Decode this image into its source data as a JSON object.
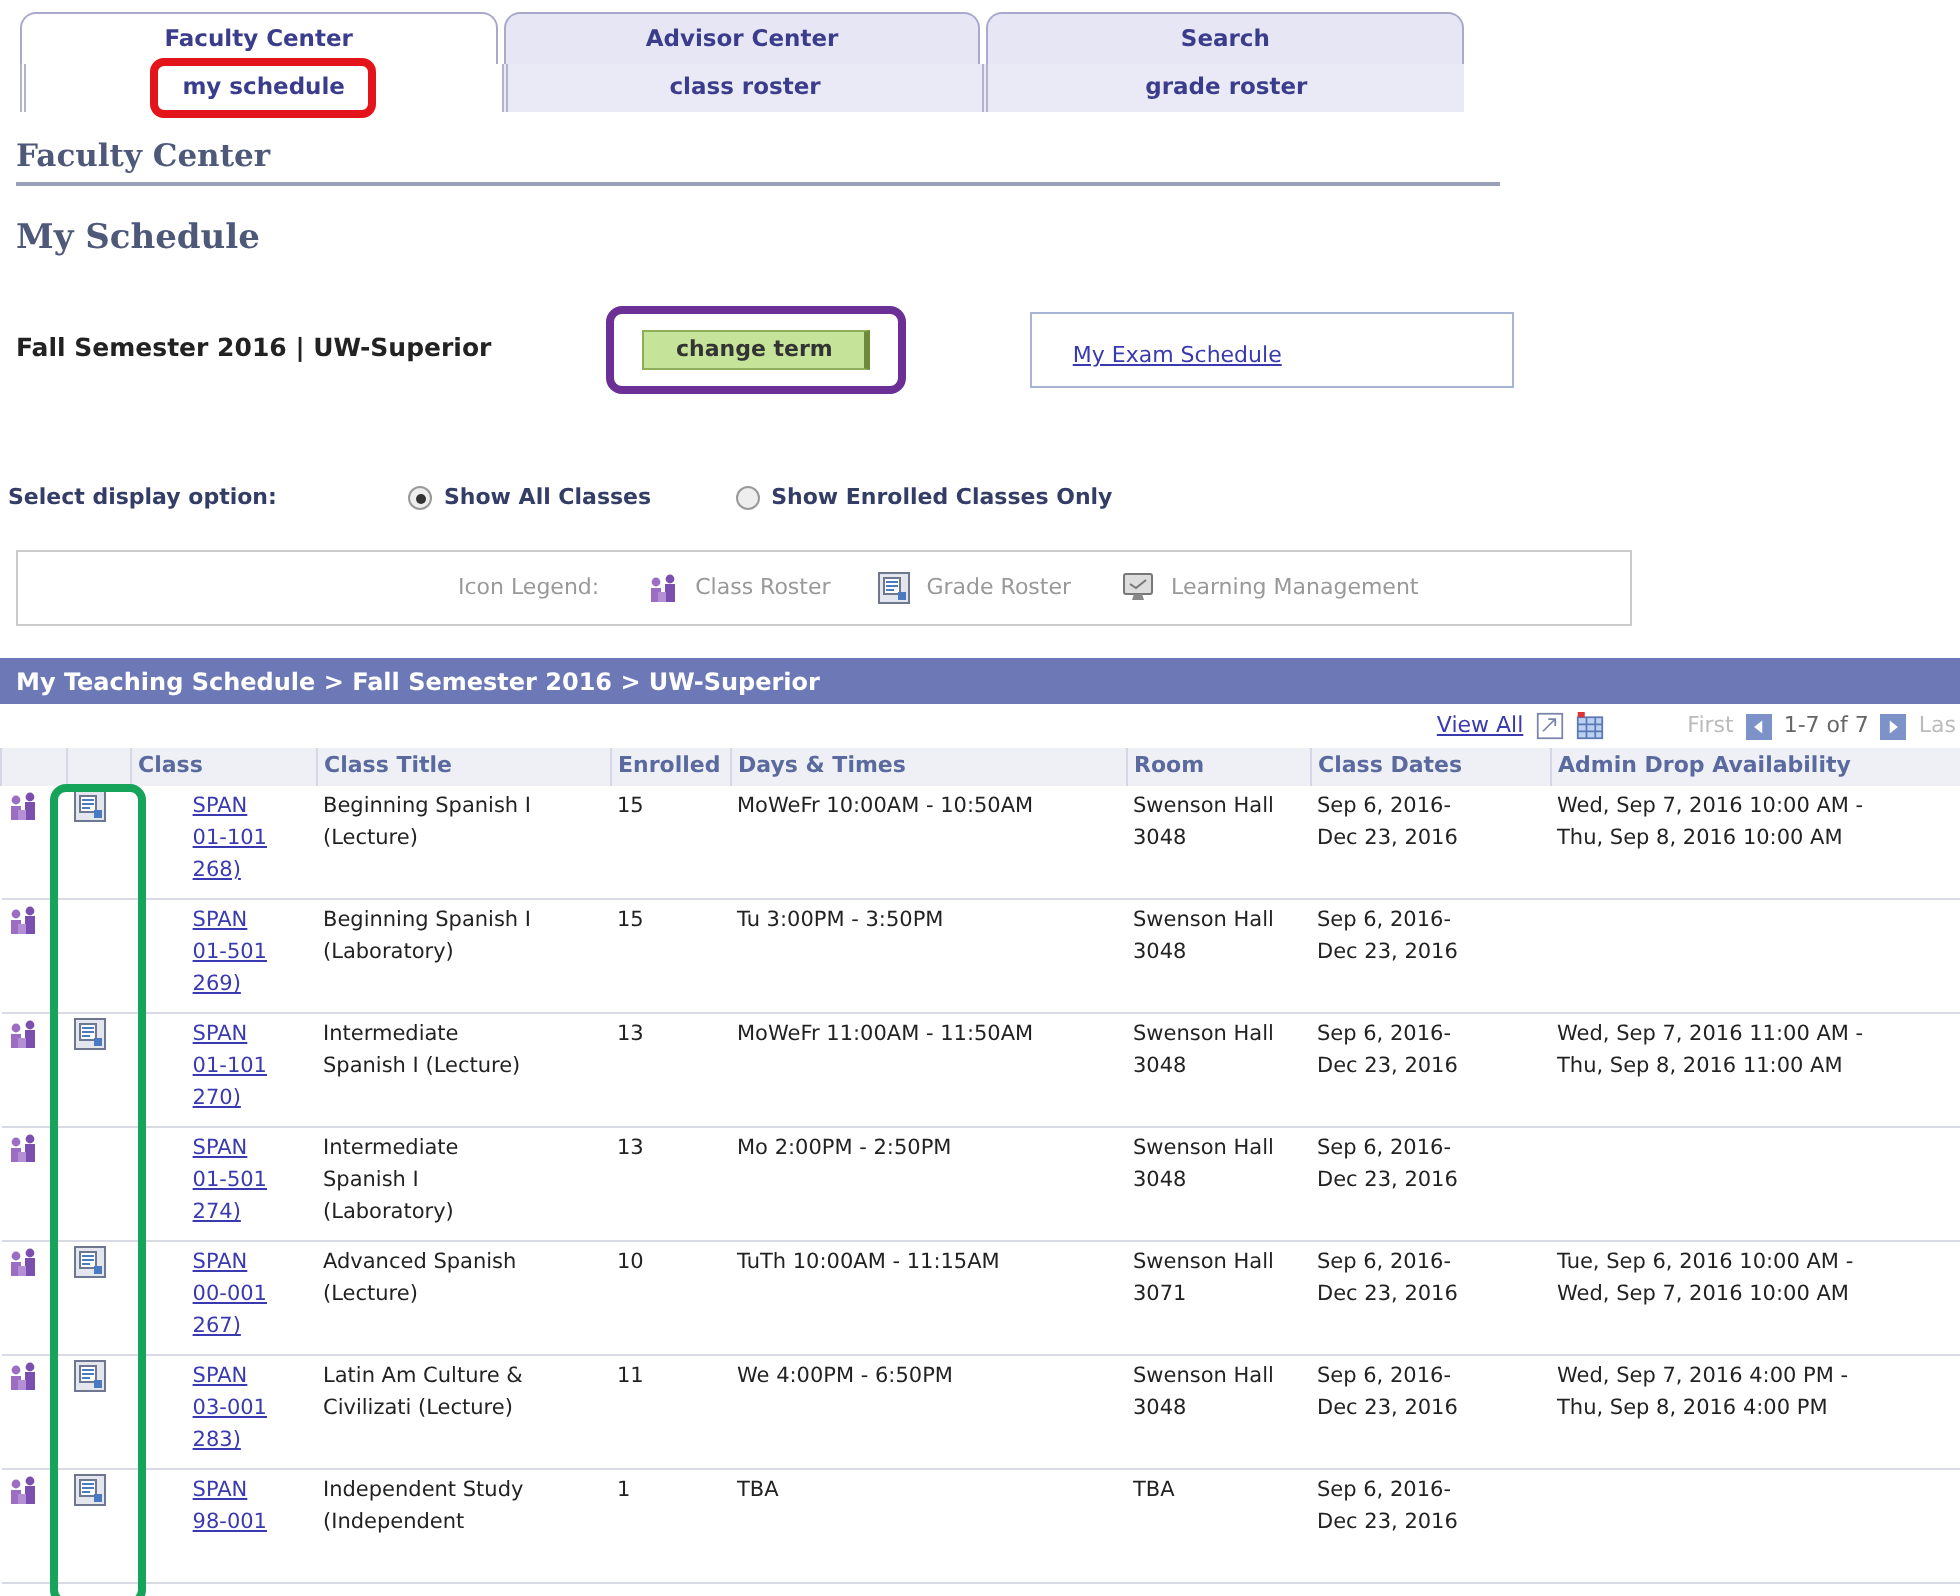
{
  "tabs": [
    {
      "label": "Faculty Center",
      "selected": true
    },
    {
      "label": "Advisor Center",
      "selected": false
    },
    {
      "label": "Search",
      "selected": false
    }
  ],
  "subtabs": [
    {
      "label": "my schedule",
      "selected": true
    },
    {
      "label": "class roster",
      "selected": false
    },
    {
      "label": "grade roster",
      "selected": false
    }
  ],
  "section_title": "Faculty Center",
  "page_title": "My Schedule",
  "term": "Fall Semester 2016 | UW-Superior",
  "change_term_button": "change term",
  "exam_link": "My Exam Schedule",
  "display_option": {
    "label": "Select display option:",
    "options": [
      {
        "label": "Show All Classes",
        "selected": true
      },
      {
        "label": "Show Enrolled Classes Only",
        "selected": false
      }
    ]
  },
  "legend": {
    "label": "Icon Legend:",
    "items": [
      {
        "kind": "class-roster",
        "label": "Class Roster"
      },
      {
        "kind": "grade-roster",
        "label": "Grade Roster"
      },
      {
        "kind": "learning",
        "label": "Learning Management"
      }
    ]
  },
  "schedule": {
    "title": "My Teaching Schedule > Fall Semester 2016 > UW-Superior",
    "view_all": "View All",
    "first": "First",
    "range": "1-7 of 7",
    "last": "Las",
    "columns": [
      "Class",
      "Class Title",
      "Enrolled",
      "Days & Times",
      "Room",
      "Class Dates",
      "Admin Drop Availability"
    ],
    "rows": [
      {
        "grade_roster": true,
        "class_lines": [
          "SPAN",
          "01-101",
          "268)"
        ],
        "title_lines": [
          "Beginning Spanish I",
          "(Lecture)"
        ],
        "enrolled": "15",
        "days": "MoWeFr 10:00AM - 10:50AM",
        "room_lines": [
          "Swenson Hall",
          "3048"
        ],
        "date_lines": [
          "Sep 6, 2016-",
          "Dec 23, 2016"
        ],
        "drop_lines": [
          "Wed, Sep 7, 2016 10:00 AM -",
          "Thu, Sep 8, 2016 10:00 AM"
        ]
      },
      {
        "grade_roster": false,
        "class_lines": [
          "SPAN",
          "01-501",
          "269)"
        ],
        "title_lines": [
          "Beginning Spanish I",
          "(Laboratory)"
        ],
        "enrolled": "15",
        "days": "Tu 3:00PM - 3:50PM",
        "room_lines": [
          "Swenson Hall",
          "3048"
        ],
        "date_lines": [
          "Sep 6, 2016-",
          "Dec 23, 2016"
        ],
        "drop_lines": []
      },
      {
        "grade_roster": true,
        "class_lines": [
          "SPAN",
          "01-101",
          "270)"
        ],
        "title_lines": [
          "Intermediate",
          "Spanish I (Lecture)"
        ],
        "enrolled": "13",
        "days": "MoWeFr 11:00AM - 11:50AM",
        "room_lines": [
          "Swenson Hall",
          "3048"
        ],
        "date_lines": [
          "Sep 6, 2016-",
          "Dec 23, 2016"
        ],
        "drop_lines": [
          "Wed, Sep 7, 2016 11:00 AM -",
          "Thu, Sep 8, 2016 11:00 AM"
        ]
      },
      {
        "grade_roster": false,
        "class_lines": [
          "SPAN",
          "01-501",
          "274)"
        ],
        "title_lines": [
          "Intermediate",
          "Spanish I",
          "(Laboratory)"
        ],
        "enrolled": "13",
        "days": "Mo 2:00PM - 2:50PM",
        "room_lines": [
          "Swenson Hall",
          "3048"
        ],
        "date_lines": [
          "Sep 6, 2016-",
          "Dec 23, 2016"
        ],
        "drop_lines": []
      },
      {
        "grade_roster": true,
        "class_lines": [
          "SPAN",
          "00-001",
          "267)"
        ],
        "title_lines": [
          "Advanced Spanish",
          "(Lecture)"
        ],
        "enrolled": "10",
        "days": "TuTh 10:00AM - 11:15AM",
        "room_lines": [
          "Swenson Hall",
          "3071"
        ],
        "date_lines": [
          "Sep 6, 2016-",
          "Dec 23, 2016"
        ],
        "drop_lines": [
          "Tue, Sep 6, 2016 10:00 AM -",
          "Wed, Sep 7, 2016 10:00 AM"
        ]
      },
      {
        "grade_roster": true,
        "class_lines": [
          "SPAN",
          "03-001",
          "283)"
        ],
        "title_lines": [
          "Latin Am Culture &",
          "Civilizati (Lecture)"
        ],
        "enrolled": "11",
        "days": "We 4:00PM - 6:50PM",
        "room_lines": [
          "Swenson Hall",
          "3048"
        ],
        "date_lines": [
          "Sep 6, 2016-",
          "Dec 23, 2016"
        ],
        "drop_lines": [
          "Wed, Sep 7, 2016 4:00 PM -",
          "Thu, Sep 8, 2016 4:00 PM"
        ]
      },
      {
        "grade_roster": true,
        "class_lines": [
          "SPAN",
          "98-001"
        ],
        "title_lines": [
          "Independent Study",
          "(Independent"
        ],
        "enrolled": "1",
        "days": "TBA",
        "room_lines": [
          "TBA"
        ],
        "date_lines": [
          "Sep 6, 2016-",
          "Dec 23, 2016"
        ],
        "drop_lines": []
      }
    ]
  },
  "highlights": [
    {
      "color": "#e3141b"
    },
    {
      "color": "#6b2f95"
    },
    {
      "color": "#16a35a"
    }
  ]
}
